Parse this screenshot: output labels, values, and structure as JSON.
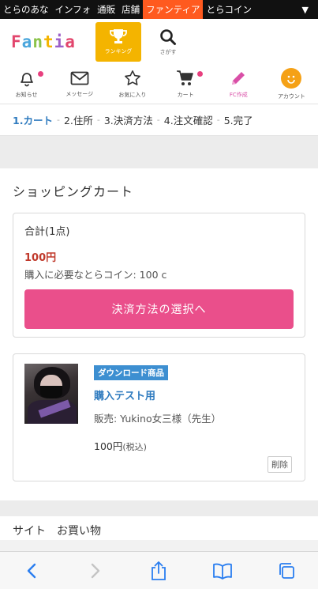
{
  "site_bar": {
    "items": [
      "とらのあな",
      "インフォ",
      "通販",
      "店舗",
      "ファンティア",
      "とらコイン"
    ],
    "active_index": 4,
    "menu_caret": "▼"
  },
  "header": {
    "logo_letters": [
      "F",
      "a",
      "n",
      "t",
      "i",
      "a"
    ],
    "logo_colors": [
      "#e2466d",
      "#4aa6dc",
      "#8bc34a",
      "#f4b400",
      "#9c5fc8",
      "#e2466d"
    ],
    "ranking_label": "ランキング",
    "search_label": "さがす"
  },
  "icon_nav": [
    {
      "icon": "bell-icon",
      "label": "お知らせ",
      "badge": true
    },
    {
      "icon": "mail-icon",
      "label": "メッセージ",
      "badge": false
    },
    {
      "icon": "star-icon",
      "label": "お気に入り",
      "badge": false
    },
    {
      "icon": "cart-icon",
      "label": "カート",
      "badge": true
    },
    {
      "icon": "pencil-icon",
      "label": "FC作成",
      "badge": false
    },
    {
      "icon": "account-icon",
      "label": "アカウント",
      "badge": false
    }
  ],
  "steps": [
    {
      "label": "1.カート",
      "current": true
    },
    {
      "label": "2.住所",
      "current": false
    },
    {
      "label": "3.決済方法",
      "current": false
    },
    {
      "label": "4.注文確認",
      "current": false
    },
    {
      "label": "5.完了",
      "current": false
    }
  ],
  "cart": {
    "title": "ショッピングカート",
    "total_label": "合計(1点)",
    "total_price": "100円",
    "coin_note": "購入に必要なとらコイン: 100 c",
    "pay_button": "決済方法の選択へ"
  },
  "item": {
    "tag": "ダウンロード商品",
    "title": "購入テスト用",
    "seller": "販売: Yukino女三様（先生）",
    "price": "100円",
    "tax_note": "(税込)",
    "delete_label": "削除"
  },
  "next_section_partial": "サイト　お買い物"
}
